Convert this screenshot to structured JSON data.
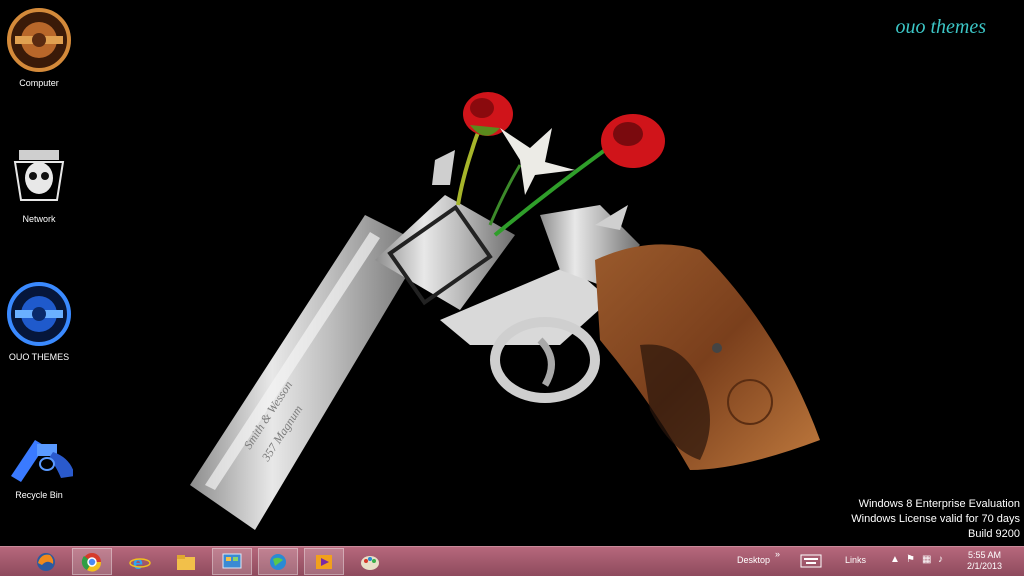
{
  "brand": "ouo themes",
  "desktop_icons": [
    {
      "label": "Computer",
      "icon": "gnr-logo-icon"
    },
    {
      "label": "Network",
      "icon": "skull-logo-icon"
    },
    {
      "label": "OUO THEMES",
      "icon": "gnr-blue-logo-icon"
    },
    {
      "label": "Recycle Bin",
      "icon": "revolver-icon"
    }
  ],
  "engravings": {
    "line1": "Smith & Wesson",
    "line2": "357 Magnum"
  },
  "watermark": {
    "line1": "Windows 8 Enterprise Evaluation",
    "line2": "Windows License valid for 70 days",
    "line3": "Build 9200"
  },
  "taskbar": {
    "apps": [
      "firefox-icon",
      "chrome-icon",
      "internet-explorer-icon",
      "file-explorer-icon",
      "control-panel-icon",
      "network-globe-icon",
      "media-icon",
      "paint-icon"
    ],
    "desktop_label": "Desktop",
    "chevron": "»",
    "links_label": "Links",
    "clock_time": "5:55 AM",
    "clock_date": "2/1/2013"
  },
  "colors": {
    "taskbar": "#a35b6f",
    "brand": "#3cc6c6",
    "rose": "#d0141a"
  }
}
